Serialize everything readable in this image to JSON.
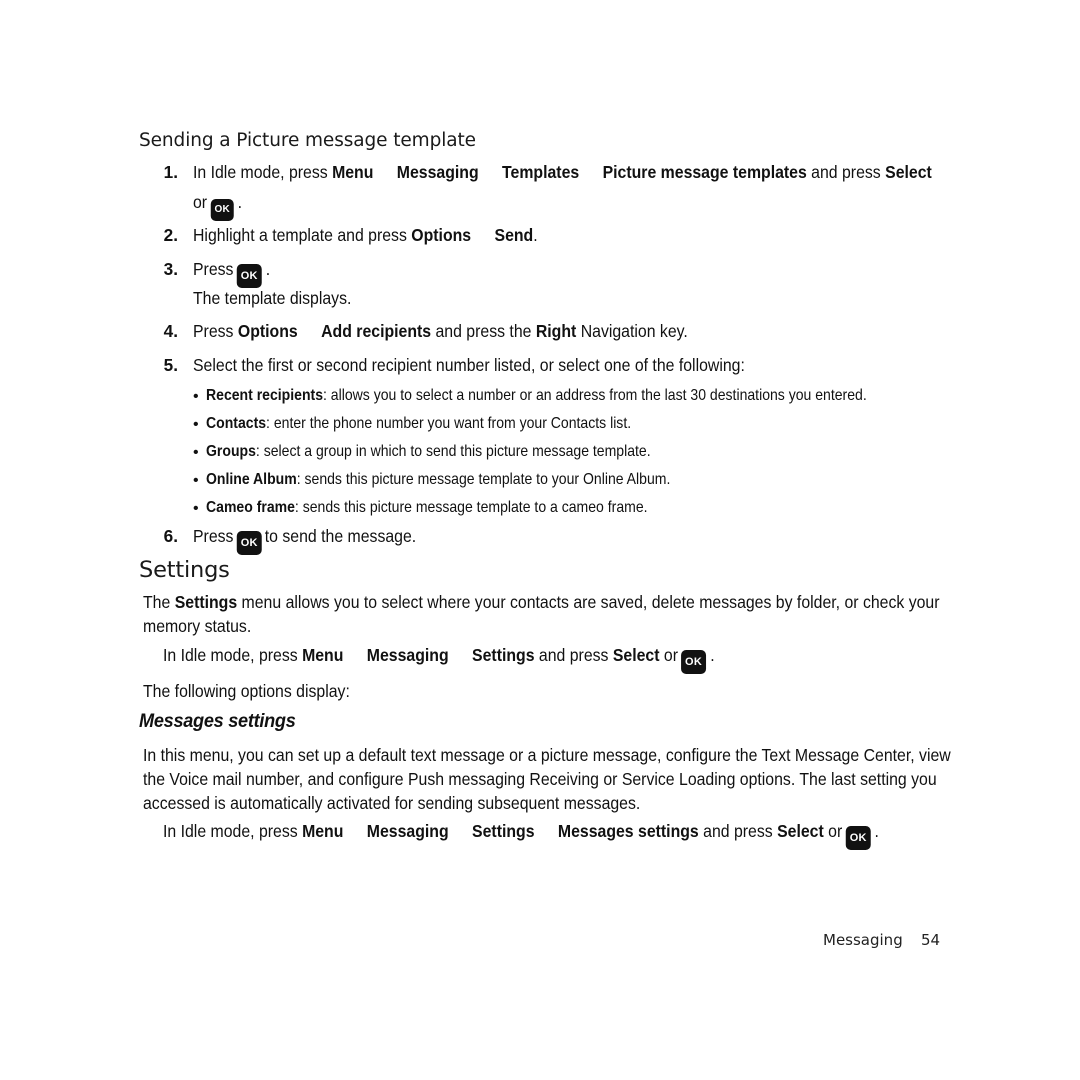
{
  "document": {
    "section_heading": "Sending a Picture message template",
    "settings_heading": "Settings",
    "messages_settings_heading": "Messages settings"
  },
  "steps": [
    {
      "number": "1.",
      "line1_prefix": "In Idle mode, press ",
      "line1_menu": [
        "Menu",
        "Messaging",
        "Templates",
        "Picture message templates"
      ],
      "line1_mid": " and press ",
      "line1_bold_end": "Select",
      "line2_prefix": "or ",
      "line2_key": "OK",
      "line2_suffix": "."
    },
    {
      "number": "2.",
      "text_prefix": "Highlight a template and press ",
      "bold_a": "Options",
      "bold_b": "Send",
      "suffix": "."
    },
    {
      "number": "3.",
      "text_prefix": "Press ",
      "key": "OK",
      "suffix": ".",
      "subline": "The template displays."
    },
    {
      "number": "4.",
      "text_prefix": "Press ",
      "bold_a": "Options",
      "bold_b": "Add recipients",
      "mid": " and press the ",
      "bold_c": "Right",
      "suffix": " Navigation key."
    },
    {
      "number": "5.",
      "text": "Select the first or second recipient number listed, or select one of the following:"
    },
    {
      "number": "6.",
      "text_prefix": "Press ",
      "key": "OK",
      "suffix": " to send the message."
    }
  ],
  "recipient_options": [
    {
      "term": "Recent recipients",
      "desc": ": allows you to select a number or an address from the last 30 destinations you entered."
    },
    {
      "term": "Contacts",
      "desc": ": enter the phone number you want from your Contacts list."
    },
    {
      "term": "Groups",
      "desc": ": select a group in which to send this picture message template."
    },
    {
      "term": "Online Album",
      "desc": ": sends this picture message template to your Online Album."
    },
    {
      "term": "Cameo frame",
      "desc": ": sends this picture message template to a cameo frame."
    }
  ],
  "settings_section": {
    "intro_prefix": "The ",
    "intro_bold": "Settings",
    "intro_rest": " menu allows you to select where your contacts are saved, delete messages by folder, or check your memory status.",
    "path_prefix": "In Idle mode, press ",
    "path_items": [
      "Menu",
      "Messaging",
      "Settings"
    ],
    "path_mid": " and press ",
    "path_bold_end": "Select",
    "path_or": " or ",
    "path_key": "OK",
    "path_suffix": ".",
    "following": "The following options display:"
  },
  "messages_settings_section": {
    "paragraph": "In this menu, you can set up a default text message or a picture message, configure the Text Message Center, view the Voice mail number, and configure Push messaging Receiving or Service Loading options. The last setting you accessed is automatically activated for sending subsequent messages.",
    "path_prefix": "In Idle mode, press ",
    "path_items": [
      "Menu",
      "Messaging",
      "Settings",
      "Messages settings"
    ],
    "path_mid": " and press ",
    "path_bold_end": "Select",
    "path_or": " or ",
    "path_key": "OK",
    "path_suffix": "."
  },
  "footer": {
    "chapter": "Messaging",
    "page_number": "54"
  }
}
